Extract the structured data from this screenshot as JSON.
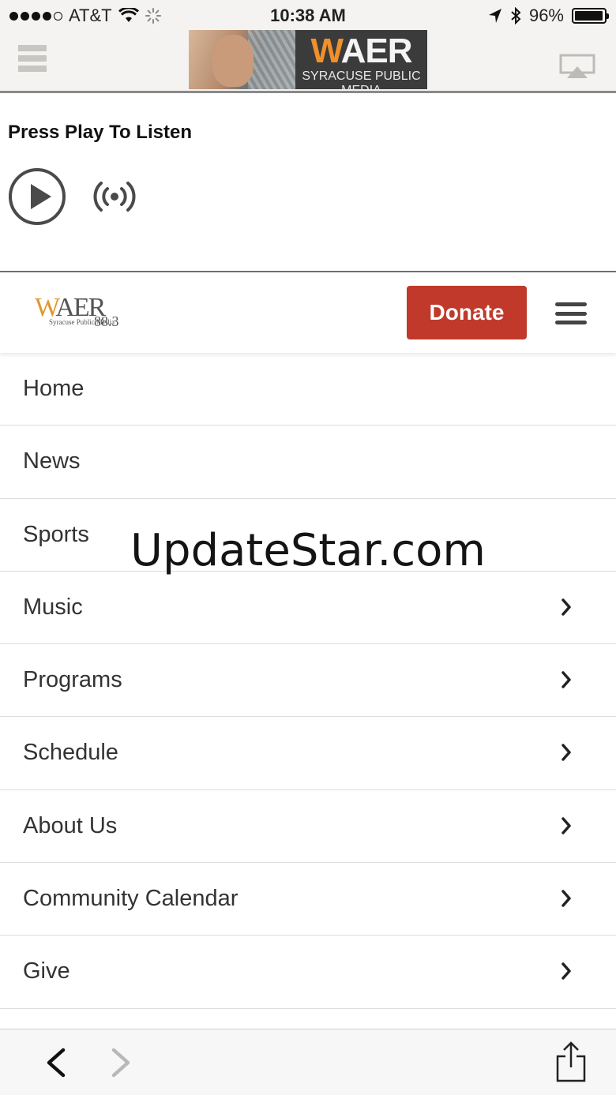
{
  "status_bar": {
    "carrier": "AT&T",
    "time": "10:38 AM",
    "battery": "96%",
    "battery_level": 0.96
  },
  "app_header": {
    "banner": {
      "title_accent": "W",
      "title_rest": "AER",
      "subtitle": "SYRACUSE PUBLIC MEDIA"
    }
  },
  "player": {
    "prompt": "Press Play To Listen"
  },
  "site_header": {
    "logo": {
      "accent": "W",
      "rest": "AER",
      "tagline": "Syracuse Public Media",
      "frequency": "88.3"
    },
    "donate_label": "Donate"
  },
  "menu": {
    "items": [
      {
        "label": "Home",
        "has_chevron": false
      },
      {
        "label": "News",
        "has_chevron": false
      },
      {
        "label": "Sports",
        "has_chevron": false
      },
      {
        "label": "Music",
        "has_chevron": true
      },
      {
        "label": "Programs",
        "has_chevron": true
      },
      {
        "label": "Schedule",
        "has_chevron": true
      },
      {
        "label": "About Us",
        "has_chevron": true
      },
      {
        "label": "Community Calendar",
        "has_chevron": true
      },
      {
        "label": "Give",
        "has_chevron": true
      }
    ]
  },
  "watermark": "UpdateStar.com",
  "colors": {
    "donate": "#c0392b",
    "accent_orange": "#f0902a",
    "header_bg": "#f4f3f1"
  },
  "icons": {
    "menu": "hamburger-icon",
    "airplay": "airplay-icon",
    "play": "play-icon",
    "stream": "broadcast-icon",
    "chevron": "chevron-right-icon",
    "back": "back-arrow-icon",
    "forward": "forward-arrow-icon",
    "share": "share-icon"
  }
}
